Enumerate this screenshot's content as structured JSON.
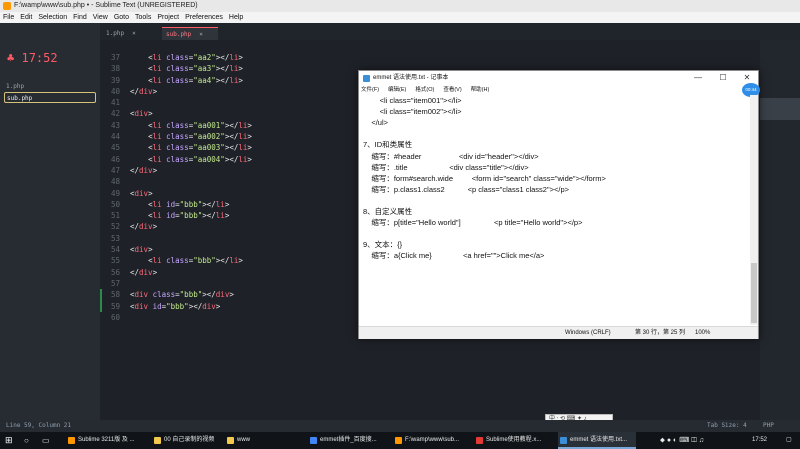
{
  "window_title": "F:\\wamp\\www\\sub.php • - Sublime Text (UNREGISTERED)",
  "menu": [
    "File",
    "Edit",
    "Selection",
    "Find",
    "View",
    "Goto",
    "Tools",
    "Project",
    "Preferences",
    "Help"
  ],
  "clock_time": "17:52",
  "sidebar_files": [
    {
      "name": "1.php",
      "active": false
    },
    {
      "name": "sub.php",
      "active": true
    }
  ],
  "tabs": [
    {
      "label": "1.php",
      "active": false
    },
    {
      "label": "sub.php",
      "active": true
    }
  ],
  "tab_close": "×",
  "line_numbers": [
    "37",
    "38",
    "39",
    "40",
    "41",
    "42",
    "43",
    "44",
    "45",
    "46",
    "47",
    "48",
    "49",
    "50",
    "51",
    "52",
    "53",
    "54",
    "55",
    "56",
    "57",
    "58",
    "59",
    "60"
  ],
  "code_lines": [
    {
      "indent": "    ",
      "parts": [
        [
          "punct",
          "<"
        ],
        [
          "tag",
          "li"
        ],
        [
          "attr",
          " class"
        ],
        [
          "punct",
          "="
        ],
        [
          "str",
          "\"aa2\""
        ],
        [
          "punct",
          "></"
        ],
        [
          "tag",
          "li"
        ],
        [
          "punct",
          ">"
        ]
      ]
    },
    {
      "indent": "    ",
      "parts": [
        [
          "punct",
          "<"
        ],
        [
          "tag",
          "li"
        ],
        [
          "attr",
          " class"
        ],
        [
          "punct",
          "="
        ],
        [
          "str",
          "\"aa3\""
        ],
        [
          "punct",
          "></"
        ],
        [
          "tag",
          "li"
        ],
        [
          "punct",
          ">"
        ]
      ]
    },
    {
      "indent": "    ",
      "parts": [
        [
          "punct",
          "<"
        ],
        [
          "tag",
          "li"
        ],
        [
          "attr",
          " class"
        ],
        [
          "punct",
          "="
        ],
        [
          "str",
          "\"aa4\""
        ],
        [
          "punct",
          "></"
        ],
        [
          "tag",
          "li"
        ],
        [
          "punct",
          ">"
        ]
      ]
    },
    {
      "indent": "",
      "parts": [
        [
          "punct",
          "</"
        ],
        [
          "tag",
          "div"
        ],
        [
          "punct",
          ">"
        ]
      ]
    },
    {
      "indent": "",
      "parts": []
    },
    {
      "indent": "",
      "parts": [
        [
          "punct",
          "<"
        ],
        [
          "tag",
          "div"
        ],
        [
          "punct",
          ">"
        ]
      ]
    },
    {
      "indent": "    ",
      "parts": [
        [
          "punct",
          "<"
        ],
        [
          "tag",
          "li"
        ],
        [
          "attr",
          " class"
        ],
        [
          "punct",
          "="
        ],
        [
          "str",
          "\"aa001\""
        ],
        [
          "punct",
          "></"
        ],
        [
          "tag",
          "li"
        ],
        [
          "punct",
          ">"
        ]
      ]
    },
    {
      "indent": "    ",
      "parts": [
        [
          "punct",
          "<"
        ],
        [
          "tag",
          "li"
        ],
        [
          "attr",
          " class"
        ],
        [
          "punct",
          "="
        ],
        [
          "str",
          "\"aa002\""
        ],
        [
          "punct",
          "></"
        ],
        [
          "tag",
          "li"
        ],
        [
          "punct",
          ">"
        ]
      ]
    },
    {
      "indent": "    ",
      "parts": [
        [
          "punct",
          "<"
        ],
        [
          "tag",
          "li"
        ],
        [
          "attr",
          " class"
        ],
        [
          "punct",
          "="
        ],
        [
          "str",
          "\"aa003\""
        ],
        [
          "punct",
          "></"
        ],
        [
          "tag",
          "li"
        ],
        [
          "punct",
          ">"
        ]
      ]
    },
    {
      "indent": "    ",
      "parts": [
        [
          "punct",
          "<"
        ],
        [
          "tag",
          "li"
        ],
        [
          "attr",
          " class"
        ],
        [
          "punct",
          "="
        ],
        [
          "str",
          "\"aa004\""
        ],
        [
          "punct",
          "></"
        ],
        [
          "tag",
          "li"
        ],
        [
          "punct",
          ">"
        ]
      ]
    },
    {
      "indent": "",
      "parts": [
        [
          "punct",
          "</"
        ],
        [
          "tag",
          "div"
        ],
        [
          "punct",
          ">"
        ]
      ]
    },
    {
      "indent": "",
      "parts": []
    },
    {
      "indent": "",
      "parts": [
        [
          "punct",
          "<"
        ],
        [
          "tag",
          "div"
        ],
        [
          "punct",
          ">"
        ]
      ]
    },
    {
      "indent": "    ",
      "parts": [
        [
          "punct",
          "<"
        ],
        [
          "tag",
          "li"
        ],
        [
          "attr",
          " id"
        ],
        [
          "punct",
          "="
        ],
        [
          "str",
          "\"bbb\""
        ],
        [
          "punct",
          "></"
        ],
        [
          "tag",
          "li"
        ],
        [
          "punct",
          ">"
        ]
      ]
    },
    {
      "indent": "    ",
      "parts": [
        [
          "punct",
          "<"
        ],
        [
          "tag",
          "li"
        ],
        [
          "attr",
          " id"
        ],
        [
          "punct",
          "="
        ],
        [
          "str",
          "\"bbb\""
        ],
        [
          "punct",
          "></"
        ],
        [
          "tag",
          "li"
        ],
        [
          "punct",
          ">"
        ]
      ]
    },
    {
      "indent": "",
      "parts": [
        [
          "punct",
          "</"
        ],
        [
          "tag",
          "div"
        ],
        [
          "punct",
          ">"
        ]
      ]
    },
    {
      "indent": "",
      "parts": []
    },
    {
      "indent": "",
      "parts": [
        [
          "punct",
          "<"
        ],
        [
          "tag",
          "div"
        ],
        [
          "punct",
          ">"
        ]
      ]
    },
    {
      "indent": "    ",
      "parts": [
        [
          "punct",
          "<"
        ],
        [
          "tag",
          "li"
        ],
        [
          "attr",
          " class"
        ],
        [
          "punct",
          "="
        ],
        [
          "str",
          "\"bbb\""
        ],
        [
          "punct",
          "></"
        ],
        [
          "tag",
          "li"
        ],
        [
          "punct",
          ">"
        ]
      ]
    },
    {
      "indent": "",
      "parts": [
        [
          "punct",
          "</"
        ],
        [
          "tag",
          "div"
        ],
        [
          "punct",
          ">"
        ]
      ]
    },
    {
      "indent": "",
      "parts": []
    },
    {
      "indent": "",
      "parts": [
        [
          "punct",
          "<"
        ],
        [
          "tag",
          "div"
        ],
        [
          "attr",
          " class"
        ],
        [
          "punct",
          "="
        ],
        [
          "str",
          "\"bbb\""
        ],
        [
          "punct",
          "></"
        ],
        [
          "tag",
          "div"
        ],
        [
          "punct",
          ">"
        ]
      ]
    },
    {
      "indent": "",
      "parts": [
        [
          "punct",
          "<"
        ],
        [
          "tag",
          "div"
        ],
        [
          "attr",
          " id"
        ],
        [
          "punct",
          "="
        ],
        [
          "str",
          "\"bbb\""
        ],
        [
          "punct",
          "></"
        ],
        [
          "tag",
          "div"
        ],
        [
          "punct",
          ">"
        ]
      ]
    },
    {
      "indent": "",
      "parts": []
    }
  ],
  "status": {
    "position": "Line 59, Column 21",
    "tab_size": "Tab Size: 4",
    "syntax": "PHP"
  },
  "notepad": {
    "title": "emmet 语法使用.txt - 记事本",
    "menu": [
      "文件(F)",
      "编辑(E)",
      "格式(O)",
      "查看(V)",
      "帮助(H)"
    ],
    "badge": "00:44",
    "lines": [
      "        <li class=\"item001\"></li>",
      "        <li class=\"item002\"></li>",
      "    </ul>",
      "",
      "7、ID和类属性",
      "    缩写：#header                  <div id=\"header\"></div>",
      "    缩写：.title                    <div class=\"title\"></div>",
      "    缩写：form#search.wide         <form id=\"search\" class=\"wide\"></form>",
      "    缩写：p.class1.class2           <p class=\"class1 class2\"></p>",
      "",
      "8、自定义属性",
      "    缩写：p[title=\"Hello world\"]                <p title=\"Hello world\"></p>",
      "",
      "9、文本：{}",
      "    缩写：a{Click me}               <a href=\"\">Click me</a>"
    ],
    "status": {
      "encoding": "Windows (CRLF)",
      "position": "第 30 行，第 25 列",
      "zoom": "100%"
    }
  },
  "ime_bar": "中 ⸱ ⟲ ⌨ ✦ ♪",
  "taskbar": {
    "items": [
      {
        "label": "Sublime 3211版 及 ...",
        "color": "#ff9800",
        "active": false
      },
      {
        "label": "00 自己录制的视频",
        "color": "#f2c94c",
        "active": false
      },
      {
        "label": "www",
        "color": "#f2c94c",
        "active": false
      },
      {
        "label": "emmet插件_百度搜...",
        "color": "#4285f4",
        "active": false
      },
      {
        "label": "F:\\wamp\\www\\sub...",
        "color": "#ff9800",
        "active": false
      },
      {
        "label": "Sublime使用教程.x...",
        "color": "#e53935",
        "active": false
      },
      {
        "label": "emmet 语法使用.txt...",
        "color": "#3b8ed8",
        "active": true
      }
    ],
    "tray_time": "17:52"
  }
}
